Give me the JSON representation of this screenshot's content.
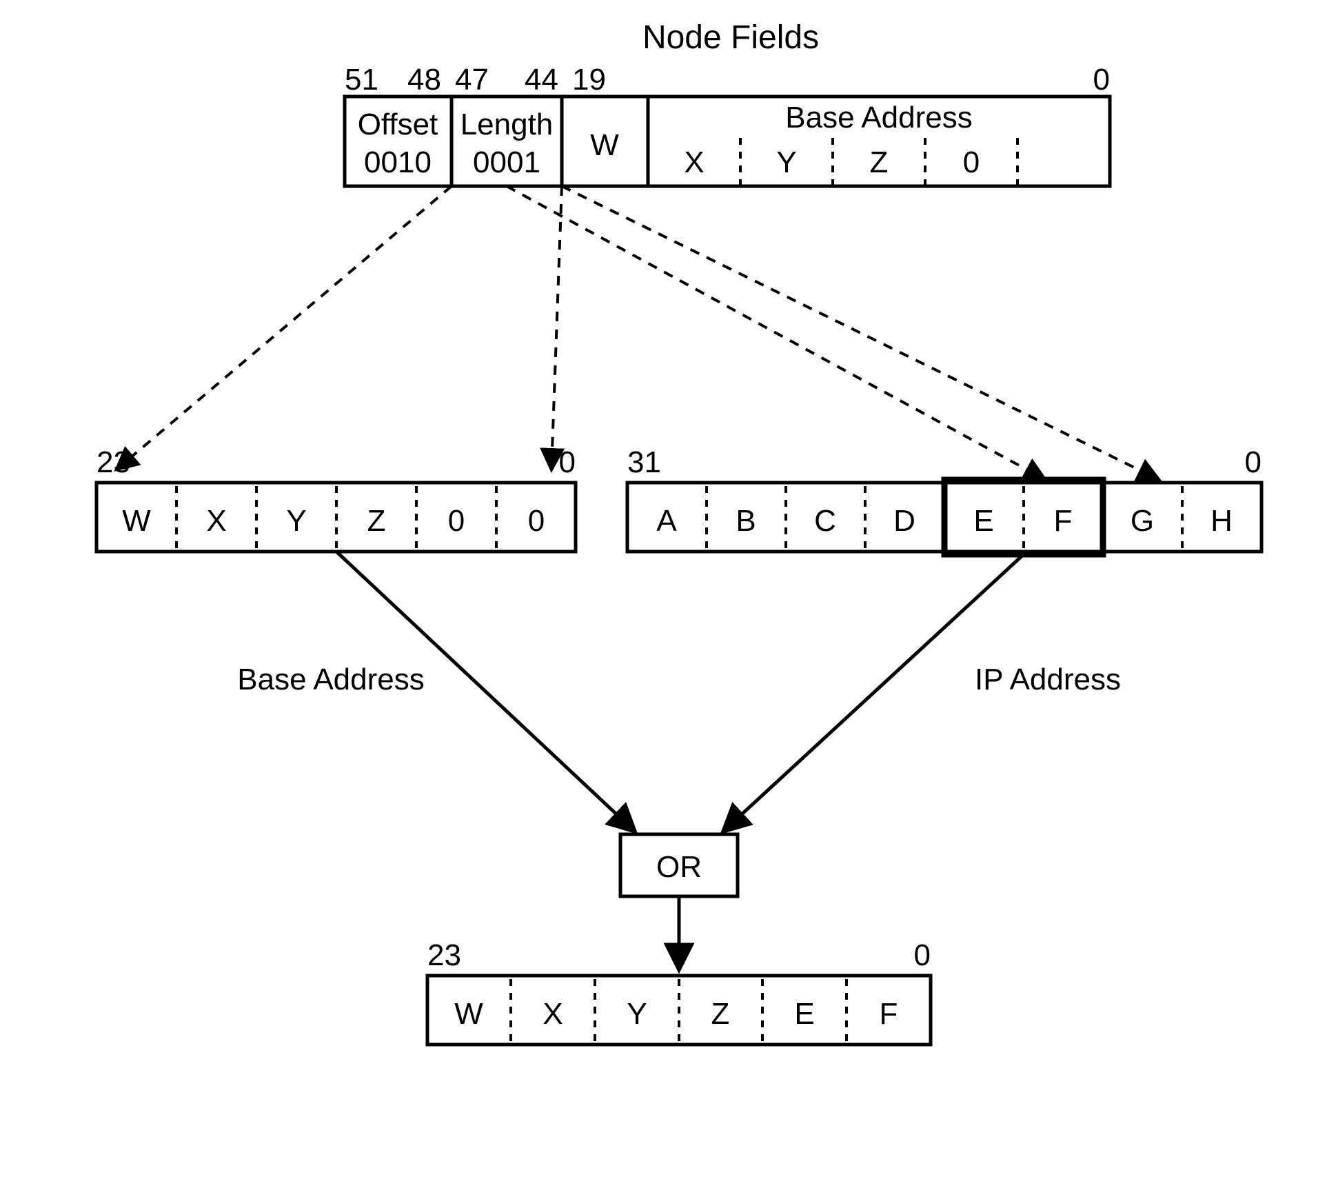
{
  "title": "Node Fields",
  "top_box": {
    "bit_labels": {
      "left": "51",
      "b48": "48",
      "b47": "47",
      "b44": "44",
      "b19": "19",
      "right": "0"
    },
    "offset": {
      "label": "Offset",
      "value": "0010"
    },
    "length": {
      "label": "Length",
      "value": "0001"
    },
    "w": "W",
    "base_address_label": "Base Address",
    "base_cells": [
      "X",
      "Y",
      "Z",
      "0"
    ]
  },
  "left_box": {
    "bit_labels": {
      "left": "23",
      "right": "0"
    },
    "cells": [
      "W",
      "X",
      "Y",
      "Z",
      "0",
      "0"
    ],
    "caption": "Base Address"
  },
  "right_box": {
    "bit_labels": {
      "left": "31",
      "right": "0"
    },
    "cells": [
      "A",
      "B",
      "C",
      "D",
      "E",
      "F",
      "G",
      "H"
    ],
    "caption": "IP Address"
  },
  "or_box": {
    "label": "OR"
  },
  "result_box": {
    "bit_labels": {
      "left": "23",
      "right": "0"
    },
    "cells": [
      "W",
      "X",
      "Y",
      "Z",
      "E",
      "F"
    ]
  }
}
